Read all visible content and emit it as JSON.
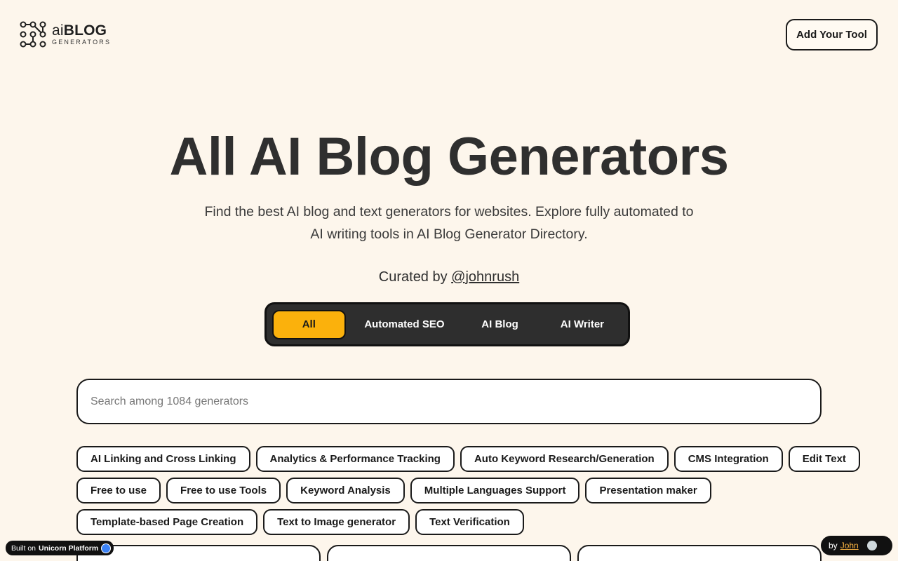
{
  "header": {
    "logo_ai": "ai",
    "logo_blog": "BLOG",
    "logo_sub": "GENERATORS",
    "add_tool_label": "Add Your Tool"
  },
  "hero": {
    "title": "All AI Blog Generators",
    "subtitle_line1": "Find the best AI blog and text generators for websites. Explore fully automated to",
    "subtitle_line2": "AI writing tools in AI Blog Generator Directory.",
    "curated_prefix": "Curated by ",
    "curated_handle": "@johnrush"
  },
  "tabs": [
    {
      "label": "All",
      "active": true
    },
    {
      "label": "Automated SEO",
      "active": false
    },
    {
      "label": "AI Blog",
      "active": false
    },
    {
      "label": "AI Writer",
      "active": false
    }
  ],
  "search": {
    "placeholder": "Search among 1084 generators"
  },
  "tags": {
    "row1": [
      "AI Linking and Cross Linking",
      "Analytics & Performance Tracking",
      "Auto Keyword Research/Generation",
      "CMS Integration",
      "Edit Text"
    ],
    "row2": [
      "Free to use",
      "Free to use Tools",
      "Keyword Analysis",
      "Multiple Languages Support",
      "Presentation maker"
    ],
    "row3": [
      "Template-based Page Creation",
      "Text to Image generator",
      "Text Verification"
    ]
  },
  "footer": {
    "built_on": "Built on",
    "platform": "Unicorn Platform",
    "by": "by",
    "author": "John"
  },
  "colors": {
    "background": "#fdf6ec",
    "accent": "#fbb10c",
    "tabs_bg": "#2e2e2e"
  }
}
